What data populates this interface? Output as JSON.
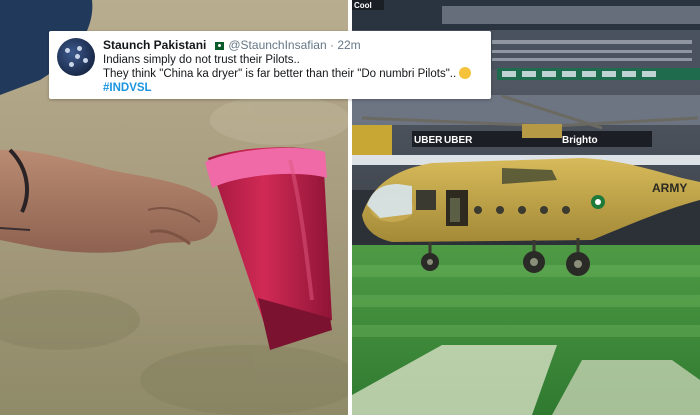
{
  "tweet": {
    "display_name": "Staunch Pakistani",
    "handle": "@StaunchInsafian",
    "separator": "·",
    "time": "22m",
    "lines": [
      "Indians simply do not trust their Pilots..",
      "They think \"China ka dryer\" is far better than their \"Do numbri Pilots\".."
    ],
    "hashtag": "#INDVSL"
  },
  "scene_text": {
    "helicopter_marking": "ARMY",
    "board_left": "UBER",
    "board_mid": "UBER",
    "board_brand": "Brighto",
    "corner_logo": "Cool"
  },
  "colors": {
    "hair_dryer": "#c8234e",
    "dryer_band": "#f06aa8",
    "helicopter": "#c9a94a",
    "pitch_green": "#3f8a3a",
    "hashtag": "#1b95e0"
  }
}
